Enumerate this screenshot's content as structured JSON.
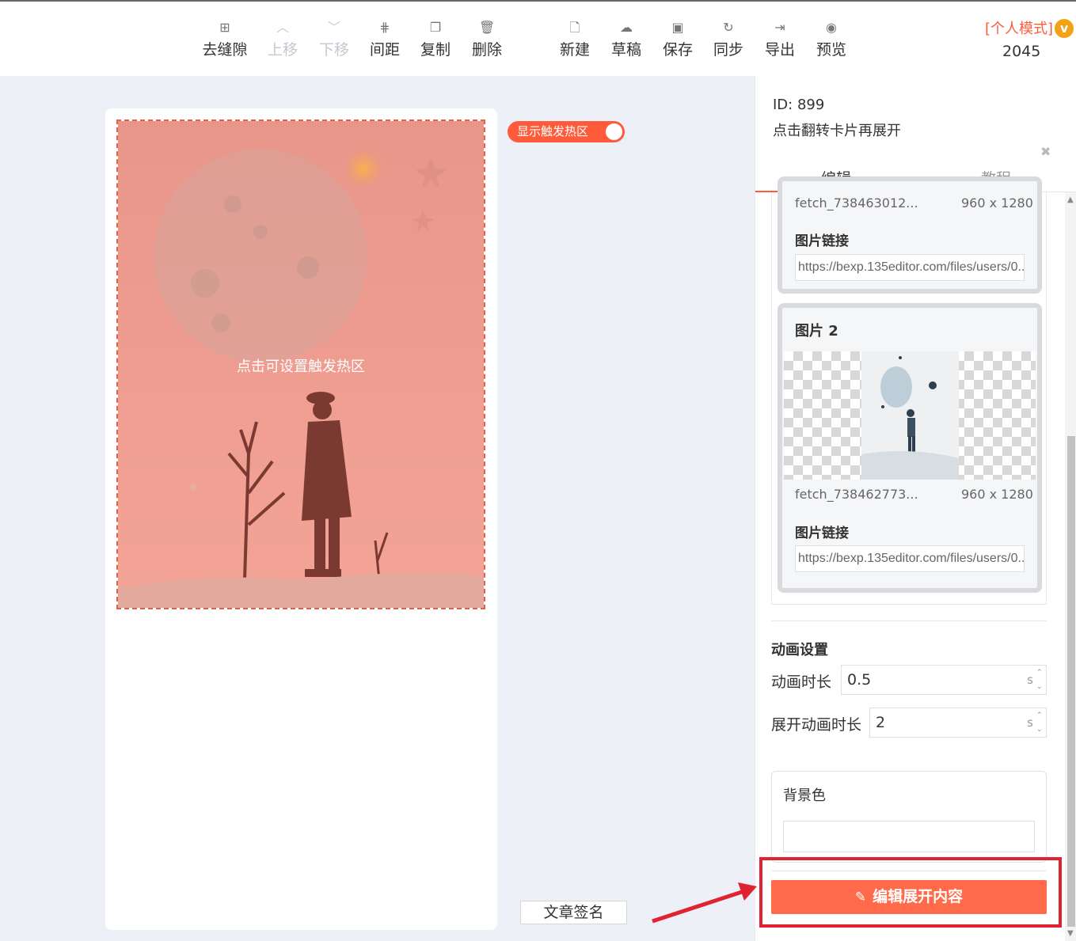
{
  "toolbar": {
    "items": [
      {
        "label": "去缝隙",
        "icon": "grid-icon",
        "disabled": false
      },
      {
        "label": "上移",
        "icon": "chevron-up-icon",
        "disabled": true
      },
      {
        "label": "下移",
        "icon": "chevron-down-icon",
        "disabled": true
      },
      {
        "label": "间距",
        "icon": "spacing-icon",
        "disabled": false
      },
      {
        "label": "复制",
        "icon": "copy-icon",
        "disabled": false
      },
      {
        "label": "删除",
        "icon": "trash-icon",
        "disabled": false
      },
      {
        "label": "新建",
        "icon": "new-file-icon",
        "disabled": false
      },
      {
        "label": "草稿",
        "icon": "cloud-icon",
        "disabled": false
      },
      {
        "label": "保存",
        "icon": "save-icon",
        "disabled": false
      },
      {
        "label": "同步",
        "icon": "sync-icon",
        "disabled": false
      },
      {
        "label": "导出",
        "icon": "export-icon",
        "disabled": false
      },
      {
        "label": "预览",
        "icon": "eye-icon",
        "disabled": false
      }
    ],
    "mode_label": "[个人模式]",
    "vip_badge": "v",
    "count": "2045"
  },
  "canvas": {
    "hot_area_label": "点击可设置触发热区",
    "toggle_label": "显示触发热区",
    "signature_button": "文章签名"
  },
  "panel": {
    "id_text": "ID: 899",
    "component_name": "点击翻转卡片再展开",
    "tabs": [
      "编辑",
      "教程"
    ],
    "image1": {
      "filename": "fetch_738463012...",
      "size": "960 x 1280",
      "link_label": "图片链接",
      "link_value": "https://bexp.135editor.com/files/users/0..."
    },
    "image2": {
      "title": "图片 2",
      "filename": "fetch_738462773...",
      "size": "960 x 1280",
      "link_label": "图片链接",
      "link_value": "https://bexp.135editor.com/files/users/0..."
    },
    "animation": {
      "section_title": "动画设置",
      "duration_label": "动画时长",
      "duration_value": "0.5",
      "expand_label": "展开动画时长",
      "expand_value": "2",
      "unit": "s"
    },
    "background": {
      "label": "背景色",
      "value": ""
    },
    "edit_button": "编辑展开内容"
  },
  "colors": {
    "accent": "#ff5b3b",
    "annotation": "#e12230"
  }
}
